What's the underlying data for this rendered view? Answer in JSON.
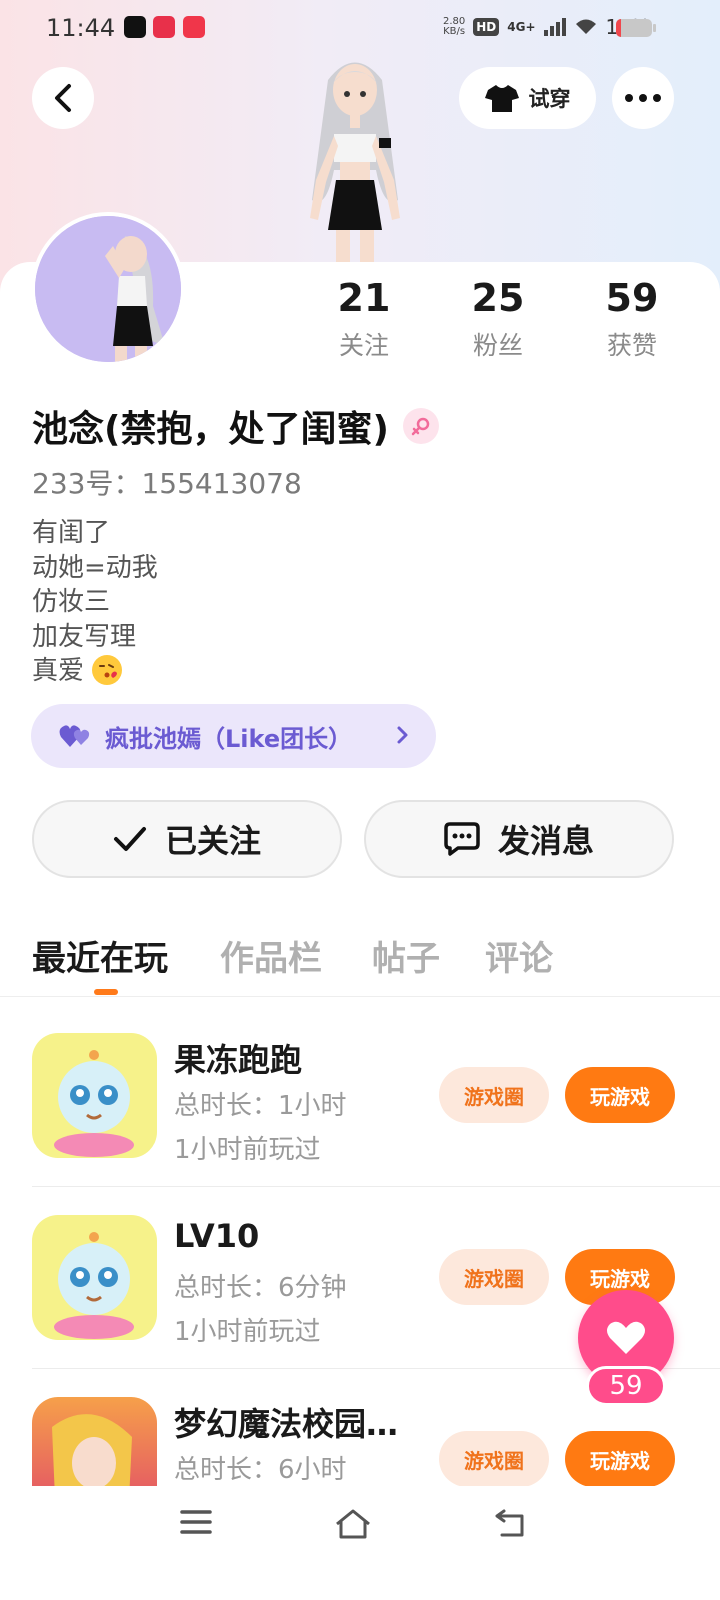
{
  "status_bar": {
    "time": "11:44",
    "net_speed_value": "2.80",
    "net_speed_unit": "KB/s",
    "hd_badge": "HD",
    "network": "4G+",
    "battery": "15%",
    "battery_level": 0.15
  },
  "header": {
    "tryon_label": "试穿"
  },
  "profile": {
    "stats": [
      {
        "value": "21",
        "label": "关注"
      },
      {
        "value": "25",
        "label": "粉丝"
      },
      {
        "value": "59",
        "label": "获赞"
      }
    ],
    "name": "池念(禁抱，处了闺蜜)",
    "uid": "233号：155413078",
    "bio_lines": [
      "有闺了",
      "动她=动我",
      "仿妆三",
      "加友写理",
      "真爱"
    ],
    "group_chip": "疯批池嫣（Like团长）"
  },
  "actions": {
    "follow_label": "已关注",
    "message_label": "发消息"
  },
  "tabs": [
    {
      "label": "最近在玩",
      "active": true
    },
    {
      "label": "作品栏",
      "active": false
    },
    {
      "label": "帖子",
      "active": false
    },
    {
      "label": "评论",
      "active": false
    }
  ],
  "games": [
    {
      "title": "果冻跑跑",
      "duration": "总时长：1小时",
      "last_played": "1小时前玩过",
      "circle_label": "游戏圈",
      "play_label": "玩游戏"
    },
    {
      "title": "LV10",
      "duration": "总时长：6分钟",
      "last_played": "1小时前玩过",
      "circle_label": "游戏圈",
      "play_label": "玩游戏"
    },
    {
      "title": "梦幻魔法校园…",
      "duration": "总时长：6小时",
      "last_played": "",
      "circle_label": "游戏圈",
      "play_label": "玩游戏"
    }
  ],
  "like_fab": {
    "count": "59"
  },
  "colors": {
    "accent_orange": "#ff7a12",
    "like_pink": "#ff4c8b",
    "chip_purple": "#6b5bd2"
  }
}
